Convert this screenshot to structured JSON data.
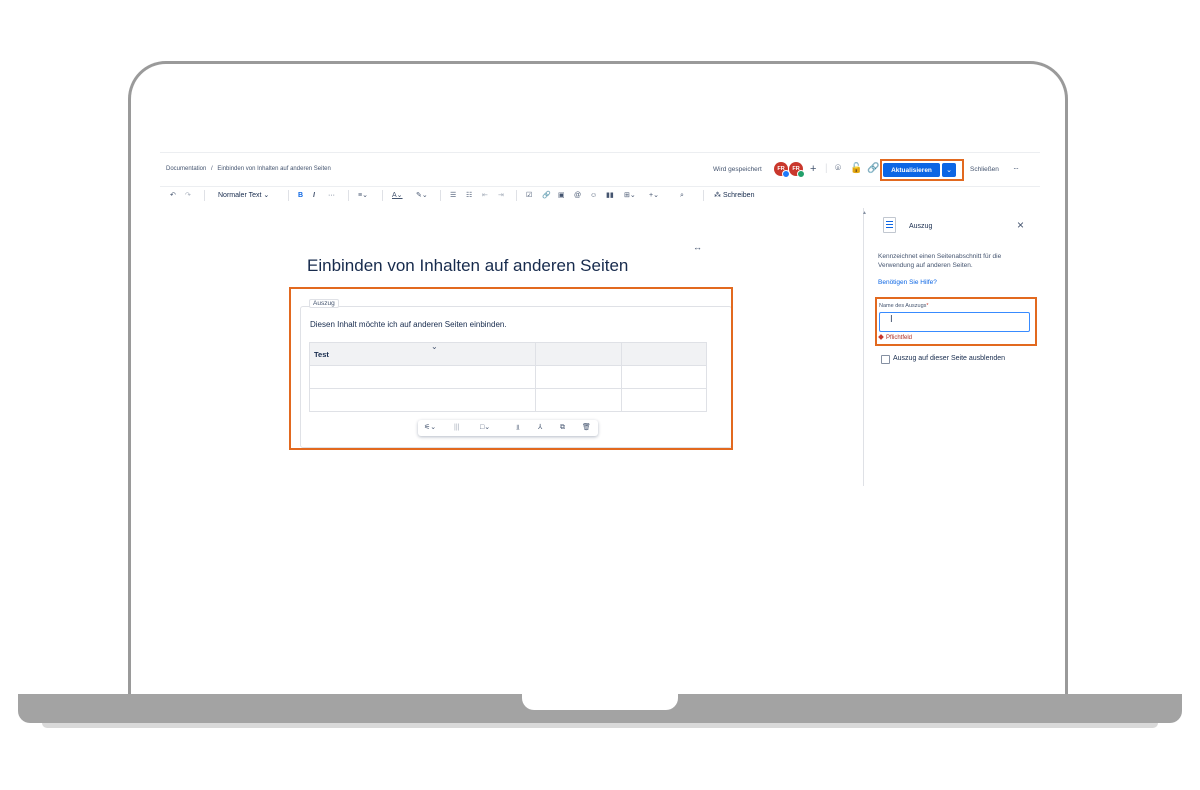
{
  "breadcrumb": {
    "space": "Documentation",
    "separator": "/",
    "page": "Einbinden von Inhalten auf anderen Seiten"
  },
  "header": {
    "save_status": "Wird gespeichert",
    "avatars": [
      {
        "initials": "FR",
        "badge_color": "#1d7afc"
      },
      {
        "initials": "FR",
        "badge_color": "#22a06b"
      }
    ],
    "update_label": "Aktualisieren",
    "close_label": "Schließen",
    "more_label": "···",
    "accent_color": "#0c66e4",
    "highlight_color": "#e2691f"
  },
  "toolbar": {
    "undo": "↶",
    "redo": "↷",
    "text_style": "Normaler Text ⌄",
    "bold": "B",
    "italic": "I",
    "more_format": "···",
    "align": "≡⌄",
    "text_color": "A⌄",
    "highlight": "✎⌄",
    "bullet_list": "☰",
    "numbered_list": "☷",
    "outdent": "⇤",
    "indent": "⇥",
    "task": "☑",
    "link": "🔗",
    "image": "▣",
    "mention": "@",
    "emoji": "☺",
    "layout": "▮▮",
    "table": "⊞⌄",
    "insert": "+⌄",
    "find": "⌕",
    "ai_write": "⁂ Schreiben"
  },
  "editor": {
    "title": "Einbinden von Inhalten auf anderen Seiten",
    "excerpt_label": "Auszug",
    "excerpt_text": "Diesen Inhalt möchte ich auf anderen Seiten einbinden.",
    "table": {
      "rows": [
        [
          "Test",
          "",
          ""
        ],
        [
          "",
          "",
          ""
        ],
        [
          "",
          "",
          ""
        ]
      ]
    },
    "table_toolbar": {
      "options": "⚟⌄",
      "columns": "|||",
      "color": "□⌄",
      "chart": "⫫",
      "tree": "⅄",
      "copy": "⧉",
      "delete": "🗑"
    },
    "resize": "↔"
  },
  "panel": {
    "title": "Auszug",
    "close": "×",
    "description": "Kennzeichnet einen Seitenabschnitt für die Verwendung auf anderen Seiten.",
    "help_link": "Benötigen Sie Hilfe?",
    "field_label": "Name des Auszugs",
    "required_mark": "*",
    "field_value": "",
    "cursor": "I",
    "error": "Pflichtfeld",
    "checkbox_label": "Auszug auf dieser Seite ausblenden",
    "checkbox_checked": false
  }
}
